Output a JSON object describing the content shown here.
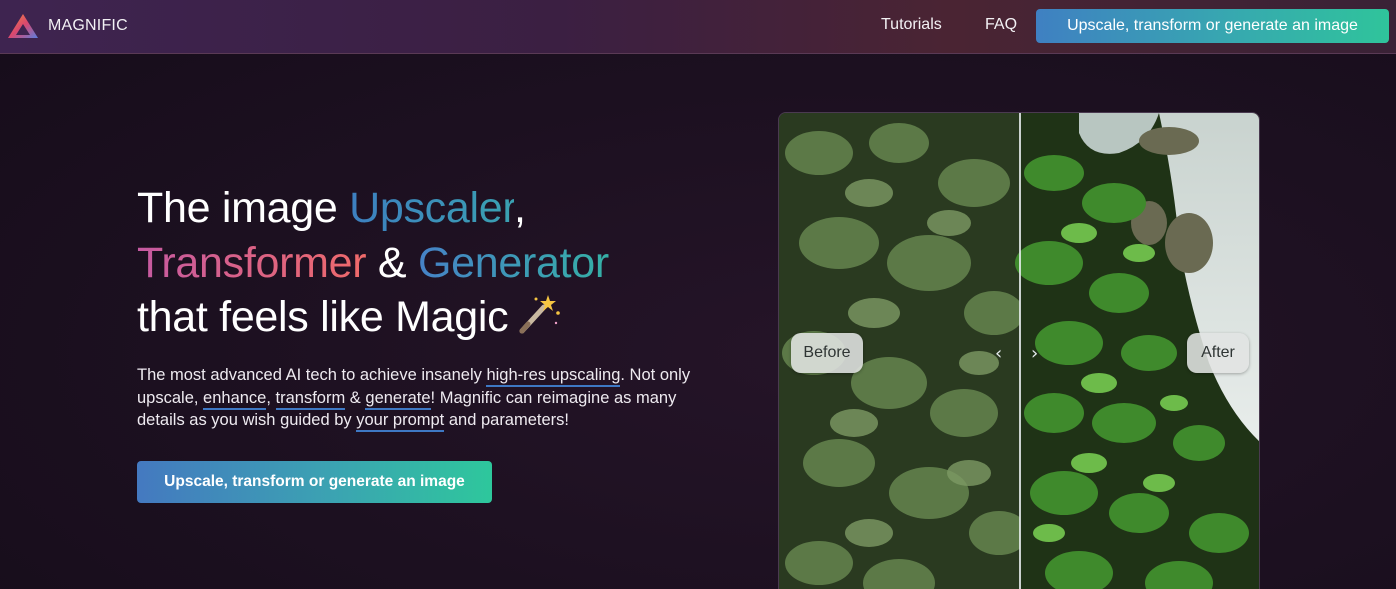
{
  "header": {
    "brand_name": "MAGNIFIC",
    "nav": [
      {
        "label": "Tutorials"
      },
      {
        "label": "FAQ"
      }
    ],
    "cta_label": "Upscale, transform or generate an image"
  },
  "hero": {
    "title": {
      "part1": "The image ",
      "highlight1": "Upscaler",
      "part2": ",",
      "highlight2": "Transformer",
      "part3": " & ",
      "highlight3": "Generator",
      "part4": "that feels like Magic"
    },
    "description": {
      "t1": "The most advanced AI tech to achieve insanely ",
      "link1": "high-res upscaling",
      "t2": ". Not only upscale, ",
      "link2": "enhance",
      "t3": ", ",
      "link3": "transform",
      "t4": " & ",
      "link4": "generate",
      "t5": "! Magnific can reimagine as many details as you wish guided by ",
      "link5": "your prompt",
      "t6": " and parameters!"
    },
    "cta_label": "Upscale, transform or generate an image"
  },
  "comparison": {
    "before_label": "Before",
    "after_label": "After",
    "left_arrow": "‹",
    "right_arrow": "›"
  },
  "colors": {
    "accent_blue": "#3f80c2",
    "accent_teal": "#2fc49b",
    "accent_pink": "#c65aa2",
    "background": "#1e1122"
  },
  "icons": {
    "logo": "triangle-logo-icon",
    "title_emoji": "magic-wand-icon"
  }
}
